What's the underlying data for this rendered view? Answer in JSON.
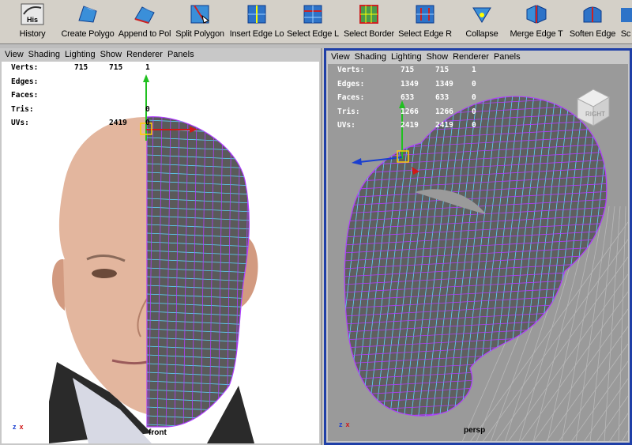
{
  "shelf": {
    "buttons": [
      {
        "label": "History",
        "icon": "history-icon",
        "icon_text": "His"
      },
      {
        "label": "Create Polygo",
        "icon": "create-polygon-icon"
      },
      {
        "label": "Append to Pol",
        "icon": "append-to-polygon-icon"
      },
      {
        "label": "Split Polygon",
        "icon": "split-polygon-icon"
      },
      {
        "label": "Insert Edge Lo",
        "icon": "insert-edge-loop-icon"
      },
      {
        "label": "Select Edge L",
        "icon": "select-edge-loop-icon"
      },
      {
        "label": "Select Border",
        "icon": "select-border-icon"
      },
      {
        "label": "Select Edge R",
        "icon": "select-edge-ring-icon"
      },
      {
        "label": "Collapse",
        "icon": "collapse-icon"
      },
      {
        "label": "Merge Edge T",
        "icon": "merge-edge-tool-icon"
      },
      {
        "label": "Soften Edge",
        "icon": "soften-edge-icon"
      },
      {
        "label": "Sc",
        "icon": "sculpt-icon"
      }
    ]
  },
  "panel_menu": [
    "View",
    "Shading",
    "Lighting",
    "Show",
    "Renderer",
    "Panels"
  ],
  "front": {
    "label": "front",
    "hud": [
      {
        "key": "Verts:",
        "v1": "715",
        "v2": "715",
        "v3": "1"
      },
      {
        "key": "Edges:",
        "v1": "",
        "v2": "",
        "v3": ""
      },
      {
        "key": "Faces:",
        "v1": "",
        "v2": "",
        "v3": ""
      },
      {
        "key": "Tris:",
        "v1": "",
        "v2": "",
        "v3": "0"
      },
      {
        "key": "UVs:",
        "v1": "",
        "v2": "2419",
        "v3": "0"
      }
    ]
  },
  "persp": {
    "label": "persp",
    "view_cube": "RIGHT",
    "hud": [
      {
        "key": "Verts:",
        "v1": "715",
        "v2": "715",
        "v3": "1"
      },
      {
        "key": "Edges:",
        "v1": "1349",
        "v2": "1349",
        "v3": "0"
      },
      {
        "key": "Faces:",
        "v1": "633",
        "v2": "633",
        "v3": "0"
      },
      {
        "key": "Tris:",
        "v1": "1266",
        "v2": "1266",
        "v3": "0"
      },
      {
        "key": "UVs:",
        "v1": "2419",
        "v2": "2419",
        "v3": "0"
      }
    ]
  },
  "axis_labels": {
    "z": "z",
    "x": "x"
  },
  "colors": {
    "wire": "#b03cff",
    "iso": "#5ed7ff",
    "mesh": "#5a5a5a",
    "active_border": "#1f3fa7",
    "hud_text": "#ffffff",
    "hud_text_front": "#000000"
  }
}
